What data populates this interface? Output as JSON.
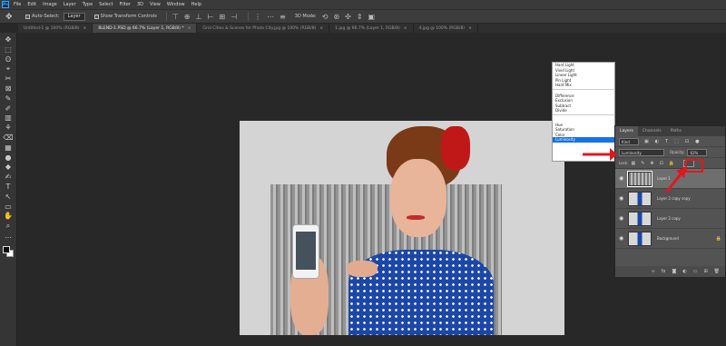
{
  "app": {
    "logo": "Ps"
  },
  "menubar": {
    "items": [
      "File",
      "Edit",
      "Image",
      "Layer",
      "Type",
      "Select",
      "Filter",
      "3D",
      "View",
      "Window",
      "Help"
    ]
  },
  "options": {
    "auto_select_label": "Auto-Select:",
    "auto_select_value": "Layer",
    "transform_label": "Show Transform Controls",
    "mode_3d_label": "3D Mode:"
  },
  "tabs": [
    {
      "label": "Untitled-1 @ 100% (RGB/8)",
      "active": false
    },
    {
      "label": "BLEND-1.PSD @ 66.7% (Layer 1, RGB/8) *",
      "active": true
    },
    {
      "label": "Grid Cities & Scenes for Photo City.jpg @ 100% (RGB/8)",
      "active": false
    },
    {
      "label": "1.jpg @ 66.7% (Layer 1, RGB/8)",
      "active": false
    },
    {
      "label": "4.jpg @ 100% (RGB/8)",
      "active": false
    }
  ],
  "tools": [
    "✥",
    "⬚",
    "ʘ",
    "⌖",
    "✂",
    "⊠",
    "✎",
    "✐",
    "▥",
    "⚘",
    "⌫",
    "▦",
    "●",
    "◆",
    "✍",
    "T",
    "↖",
    "▭",
    "✋",
    "⌕",
    "…"
  ],
  "blend_menu": {
    "group_a": [
      "Hard Light",
      "Vivid Light",
      "Linear Light",
      "Pin Light",
      "Hard Mix"
    ],
    "group_b": [
      "Difference",
      "Exclusion",
      "Subtract",
      "Divide"
    ],
    "group_c": [
      "Hue",
      "Saturation",
      "Color",
      "Luminosity"
    ],
    "selected": "Luminosity"
  },
  "layers_panel": {
    "tabs": [
      "Layers",
      "Channels",
      "Paths"
    ],
    "kind_label": "Kind",
    "blend_value": "Luminosity",
    "opacity_label": "Opacity:",
    "opacity_value": "62%",
    "lock_label": "Lock:",
    "layers": [
      {
        "name": "Layer 1",
        "selected": true
      },
      {
        "name": "Layer 2 copy copy",
        "selected": false
      },
      {
        "name": "Layer 2 copy",
        "selected": false
      },
      {
        "name": "Background",
        "selected": false
      }
    ]
  },
  "colors": {
    "highlight": "#1473e6",
    "annotation": "#e3161e"
  }
}
